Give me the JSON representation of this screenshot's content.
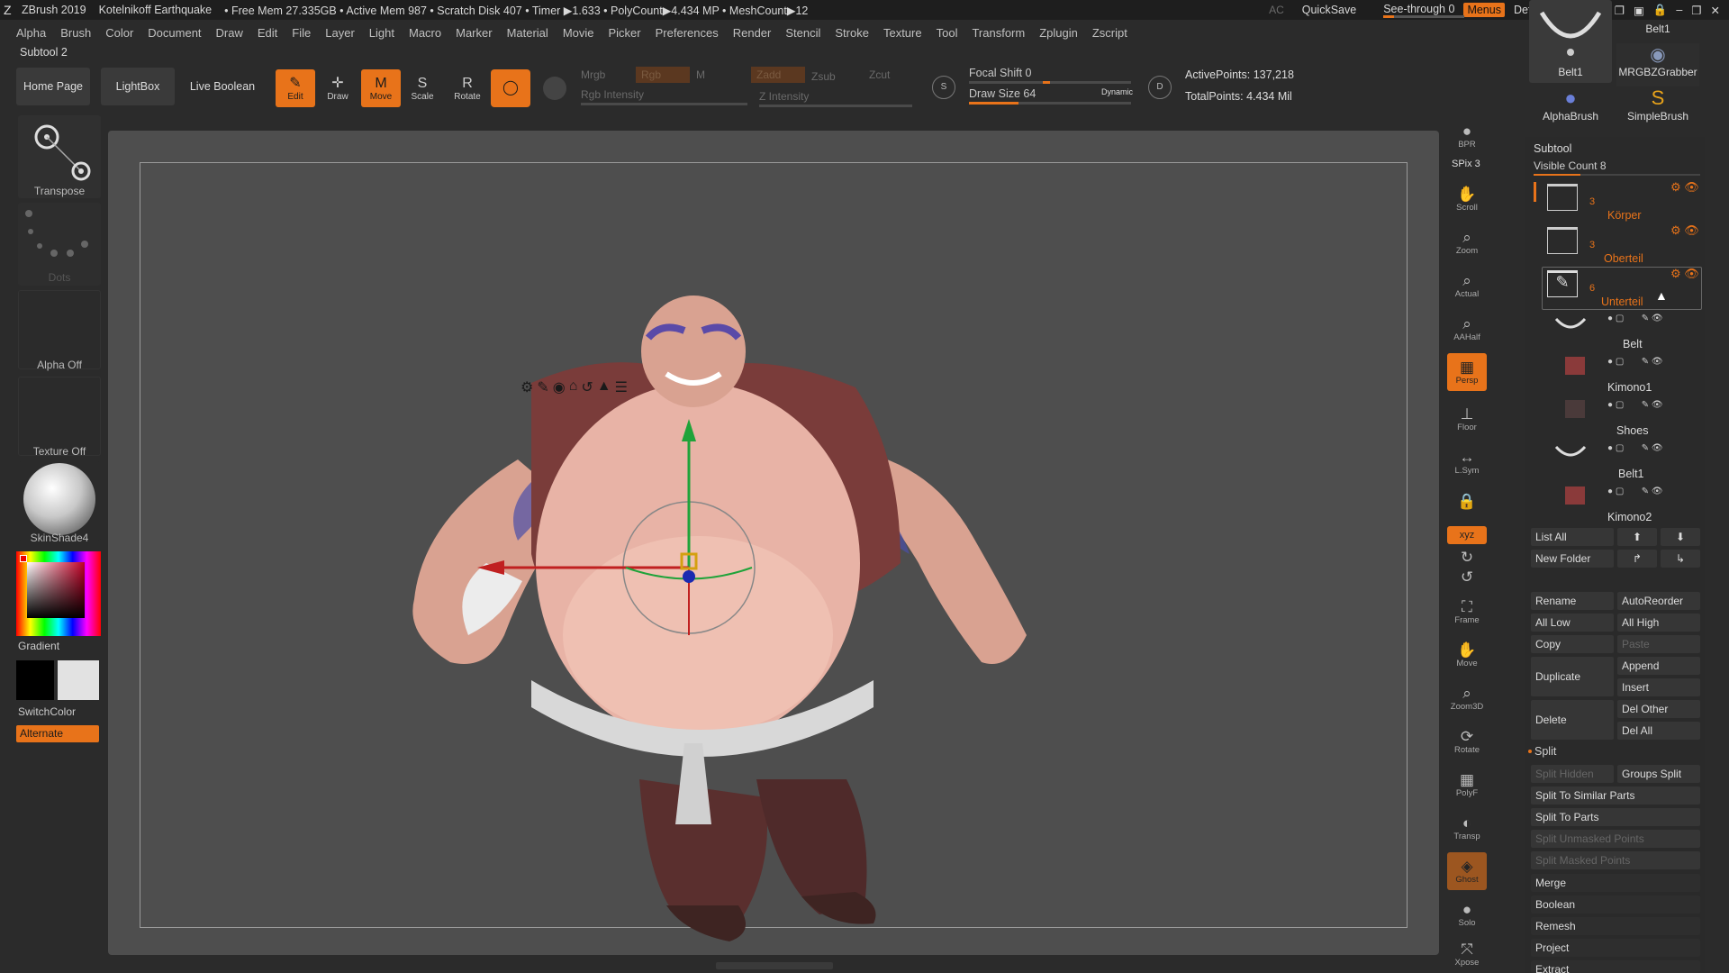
{
  "title_bar": {
    "app": "ZBrush 2019",
    "project": "Kotelnikoff Earthquake",
    "stats": "• Free Mem 27.335GB • Active Mem 987 • Scratch Disk 407 • Timer ▶1.633 • PolyCount▶4.434 MP • MeshCount▶12",
    "ac": "AC",
    "quicksave": "QuickSave",
    "seethrough": "See-through  0",
    "menus": "Menus",
    "script": "DefaultZScript"
  },
  "menu_bar": [
    "Alpha",
    "Brush",
    "Color",
    "Document",
    "Draw",
    "Edit",
    "File",
    "Layer",
    "Light",
    "Macro",
    "Marker",
    "Material",
    "Movie",
    "Picker",
    "Preferences",
    "Render",
    "Stencil",
    "Stroke",
    "Texture",
    "Tool",
    "Transform",
    "Zplugin",
    "Zscript"
  ],
  "subtool_title": "Subtool 2",
  "shelf": {
    "home_page": "Home Page",
    "lightbox": "LightBox",
    "live_boolean": "Live Boolean",
    "tools": [
      {
        "label": "Edit",
        "icon": "edit-icon",
        "glyph": "✎",
        "on": true
      },
      {
        "label": "Draw",
        "icon": "draw-icon",
        "glyph": "✛",
        "on": false
      },
      {
        "label": "Move",
        "icon": "move-icon",
        "glyph": "M",
        "on": true
      },
      {
        "label": "Scale",
        "icon": "scale-icon",
        "glyph": "S",
        "on": false
      },
      {
        "label": "Rotate",
        "icon": "rotate-icon",
        "glyph": "R",
        "on": false
      }
    ],
    "mrgb": "Mrgb",
    "rgb": "Rgb",
    "m": "M",
    "rgb_intensity": "Rgb Intensity",
    "zadd": "Zadd",
    "zsub": "Zsub",
    "zcut": "Zcut",
    "z_intensity": "Z Intensity",
    "focal_shift": "Focal Shift 0",
    "draw_size": "Draw Size 64",
    "dynamic": "Dynamic",
    "active_points": "ActivePoints: 137,218",
    "total_points": "TotalPoints: 4.434 Mil"
  },
  "left_panel": {
    "transpose": "Transpose",
    "dots": "Dots",
    "alpha_off": "Alpha Off",
    "texture_off": "Texture Off",
    "material": "SkinShade4",
    "gradient": "Gradient",
    "switchcolor": "SwitchColor",
    "alternate": "Alternate"
  },
  "right_toolbar": [
    {
      "label": "BPR",
      "name": "bpr-icon",
      "glyph": "●",
      "on": false
    },
    {
      "label": "SPix 3",
      "name": "spix-label",
      "glyph": "",
      "on": false
    },
    {
      "label": "Scroll",
      "name": "scroll-icon",
      "glyph": "✋",
      "on": false
    },
    {
      "label": "Zoom",
      "name": "zoom-icon",
      "glyph": "⌕",
      "on": false
    },
    {
      "label": "Actual",
      "name": "actual-icon",
      "glyph": "⌕",
      "on": false
    },
    {
      "label": "AAHalf",
      "name": "aahalf-icon",
      "glyph": "⌕",
      "on": false
    },
    {
      "label": "Persp",
      "name": "persp-icon",
      "glyph": "▦",
      "on": true
    },
    {
      "label": "Floor",
      "name": "floor-icon",
      "glyph": "⊥",
      "on": false
    },
    {
      "label": "L.Sym",
      "name": "lsym-icon",
      "glyph": "↔",
      "on": false
    },
    {
      "label": "",
      "name": "lock-icon",
      "glyph": "🔒",
      "on": false
    },
    {
      "label": "Qxyz",
      "name": "xyz-icon",
      "glyph": "xyz",
      "on": true
    },
    {
      "label": "",
      "name": "rotate-y-icon",
      "glyph": "↻",
      "on": false
    },
    {
      "label": "",
      "name": "rotate-z-icon",
      "glyph": "↺",
      "on": false
    },
    {
      "label": "Frame",
      "name": "frame-icon",
      "glyph": "⛶",
      "on": false
    },
    {
      "label": "Move",
      "name": "move-view-icon",
      "glyph": "✋",
      "on": false
    },
    {
      "label": "Zoom3D",
      "name": "zoom3d-icon",
      "glyph": "⌕",
      "on": false
    },
    {
      "label": "Rotate",
      "name": "rotate-view-icon",
      "glyph": "⟳",
      "on": false
    },
    {
      "label": "PolyF",
      "name": "polyf-icon",
      "glyph": "▦",
      "on": false
    },
    {
      "label": "Transp",
      "name": "transp-icon",
      "glyph": "◐",
      "on": false
    },
    {
      "label": "Ghost",
      "name": "ghost-icon",
      "glyph": "◈",
      "on": true
    },
    {
      "label": "Solo",
      "name": "solo-icon",
      "glyph": "●",
      "on": false
    },
    {
      "label": "Xpose",
      "name": "xpose-icon",
      "glyph": "⤧",
      "on": false
    }
  ],
  "top_right_brushes": [
    {
      "label": "Belt1",
      "name": "belt1-thumb"
    },
    {
      "label": "MRGBZGrabber",
      "name": "mrgbzgrabber-thumb"
    },
    {
      "label": "AlphaBrush",
      "name": "alphabrush-thumb"
    },
    {
      "label": "SimpleBrush",
      "name": "simplebrush-thumb"
    }
  ],
  "top_right_belt_label": "Belt1",
  "subtool_panel": {
    "header": "Subtool",
    "visible_count": "Visible Count 8",
    "folders": [
      {
        "name": "Körper",
        "count": "3"
      },
      {
        "name": "Oberteil",
        "count": "3"
      },
      {
        "name": "Unterteil",
        "count": "6"
      }
    ],
    "subtools": [
      "Belt",
      "Kimono1",
      "Shoes",
      "Belt1",
      "Kimono2"
    ],
    "list_all": "List All",
    "new_folder": "New Folder",
    "rename": "Rename",
    "autoreorder": "AutoReorder",
    "all_low": "All Low",
    "all_high": "All High",
    "copy": "Copy",
    "paste": "Paste",
    "duplicate": "Duplicate",
    "append": "Append",
    "insert": "Insert",
    "delete": "Delete",
    "del_other": "Del Other",
    "del_all": "Del All",
    "split": "Split",
    "split_hidden": "Split Hidden",
    "groups_split": "Groups Split",
    "split_similar": "Split To Similar Parts",
    "split_parts": "Split To Parts",
    "split_unmasked": "Split Unmasked Points",
    "split_masked": "Split Masked Points",
    "merge": "Merge",
    "boolean": "Boolean",
    "remesh": "Remesh",
    "project": "Project",
    "extract": "Extract"
  },
  "gizmo_icons": [
    "gear-icon",
    "pin-icon",
    "marker-icon",
    "home-icon",
    "undo-icon",
    "lock-icon",
    "list-icon"
  ],
  "colors": {
    "accent": "#e8731a",
    "canvas": "#4e4e4e",
    "panel": "#2b2b2b"
  }
}
